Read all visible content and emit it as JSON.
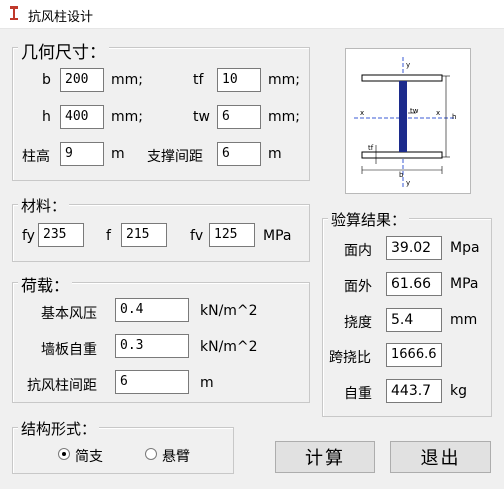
{
  "window": {
    "title": "抗风柱设计"
  },
  "geometry": {
    "legend": "几何尺寸：",
    "b_label": "b",
    "b_value": "200",
    "b_unit": "mm;",
    "tf_label": "tf",
    "tf_value": "10",
    "tf_unit": "mm;",
    "h_label": "h",
    "h_value": "400",
    "h_unit": "mm;",
    "tw_label": "tw",
    "tw_value": "6",
    "tw_unit": "mm;",
    "height_label": "柱高",
    "height_value": "9",
    "height_unit": "m",
    "brace_label": "支撑间距",
    "brace_value": "6",
    "brace_unit": "m"
  },
  "section_figure": {
    "labels": {
      "y_top": "y",
      "y_bottom": "y",
      "x_left": "x",
      "x_right": "x",
      "tw": "tw",
      "h": "h",
      "b": "b",
      "tf": "tf"
    }
  },
  "material": {
    "legend": "材料：",
    "fy_label": "fy",
    "fy_value": "235",
    "f_label": "f",
    "f_value": "215",
    "fv_label": "fv",
    "fv_value": "125",
    "unit": "MPa"
  },
  "load": {
    "legend": "荷载：",
    "wind_label": "基本风压",
    "wind_value": "0.4",
    "wind_unit": "kN/m^2",
    "wall_label": "墙板自重",
    "wall_value": "0.3",
    "wall_unit": "kN/m^2",
    "spacing_label": "抗风柱间距",
    "spacing_value": "6",
    "spacing_unit": "m"
  },
  "results": {
    "legend": "验算结果：",
    "in_plane_label": "面内",
    "in_plane_value": "39.02",
    "in_plane_unit": "Mpa",
    "out_plane_label": "面外",
    "out_plane_value": "61.66",
    "out_plane_unit": "MPa",
    "deflection_label": "挠度",
    "deflection_value": "5.4",
    "deflection_unit": "mm",
    "span_ratio_label": "跨挠比",
    "span_ratio_value": "1666.6",
    "weight_label": "自重",
    "weight_value": "443.7",
    "weight_unit": "kg"
  },
  "structure": {
    "legend": "结构形式：",
    "simple_label": "简支",
    "cantilever_label": "悬臂",
    "selected": "simple"
  },
  "buttons": {
    "calc_label": "计算",
    "exit_label": "退出"
  }
}
